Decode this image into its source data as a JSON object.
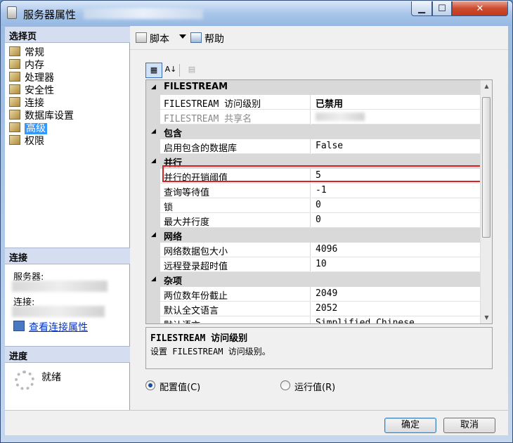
{
  "window": {
    "title": "服务器属性"
  },
  "nav": {
    "select_page_header": "选择页",
    "items": [
      {
        "label": "常规"
      },
      {
        "label": "内存"
      },
      {
        "label": "处理器"
      },
      {
        "label": "安全性"
      },
      {
        "label": "连接"
      },
      {
        "label": "数据库设置"
      },
      {
        "label": "高级",
        "selected": true
      },
      {
        "label": "权限"
      }
    ],
    "connection_header": "连接",
    "server_label": "服务器:",
    "connection_label": "连接:",
    "view_connection_properties": "查看连接属性",
    "progress_header": "进度",
    "progress_status": "就绪"
  },
  "toolbar": {
    "script_label": "脚本",
    "help_label": "帮助"
  },
  "grid": {
    "rows": [
      {
        "kind": "category",
        "label": "FILESTREAM"
      },
      {
        "kind": "property",
        "name": "FILESTREAM 访问级别",
        "value": "已禁用",
        "bold_value": true
      },
      {
        "kind": "property",
        "name": "FILESTREAM 共享名",
        "value": "",
        "disabled": true
      },
      {
        "kind": "category",
        "label": "包含"
      },
      {
        "kind": "property",
        "name": "启用包含的数据库",
        "value": "False"
      },
      {
        "kind": "category",
        "label": "并行"
      },
      {
        "kind": "property",
        "name": "并行的开销阈值",
        "value": "5"
      },
      {
        "kind": "property",
        "name": "查询等待值",
        "value": "-1"
      },
      {
        "kind": "property",
        "name": "锁",
        "value": "0"
      },
      {
        "kind": "property",
        "name": "最大并行度",
        "value": "0"
      },
      {
        "kind": "category",
        "label": "网络"
      },
      {
        "kind": "property",
        "name": "网络数据包大小",
        "value": "4096"
      },
      {
        "kind": "property",
        "name": "远程登录超时值",
        "value": "10"
      },
      {
        "kind": "category",
        "label": "杂项"
      },
      {
        "kind": "property",
        "name": "两位数年份截止",
        "value": "2049"
      },
      {
        "kind": "property",
        "name": "默认全文语言",
        "value": "2052"
      },
      {
        "kind": "property",
        "name": "默认语言",
        "value": "Simplified Chinese"
      }
    ]
  },
  "description": {
    "title": "FILESTREAM 访问级别",
    "text": "设置 FILESTREAM 访问级别。"
  },
  "radios": {
    "configured": "配置值(C)",
    "running": "运行值(R)"
  },
  "buttons": {
    "ok": "确定",
    "cancel": "取消"
  },
  "colors": {
    "selection": "#3399ff",
    "highlight_border": "#d42424",
    "section_header": "#d5def0"
  }
}
